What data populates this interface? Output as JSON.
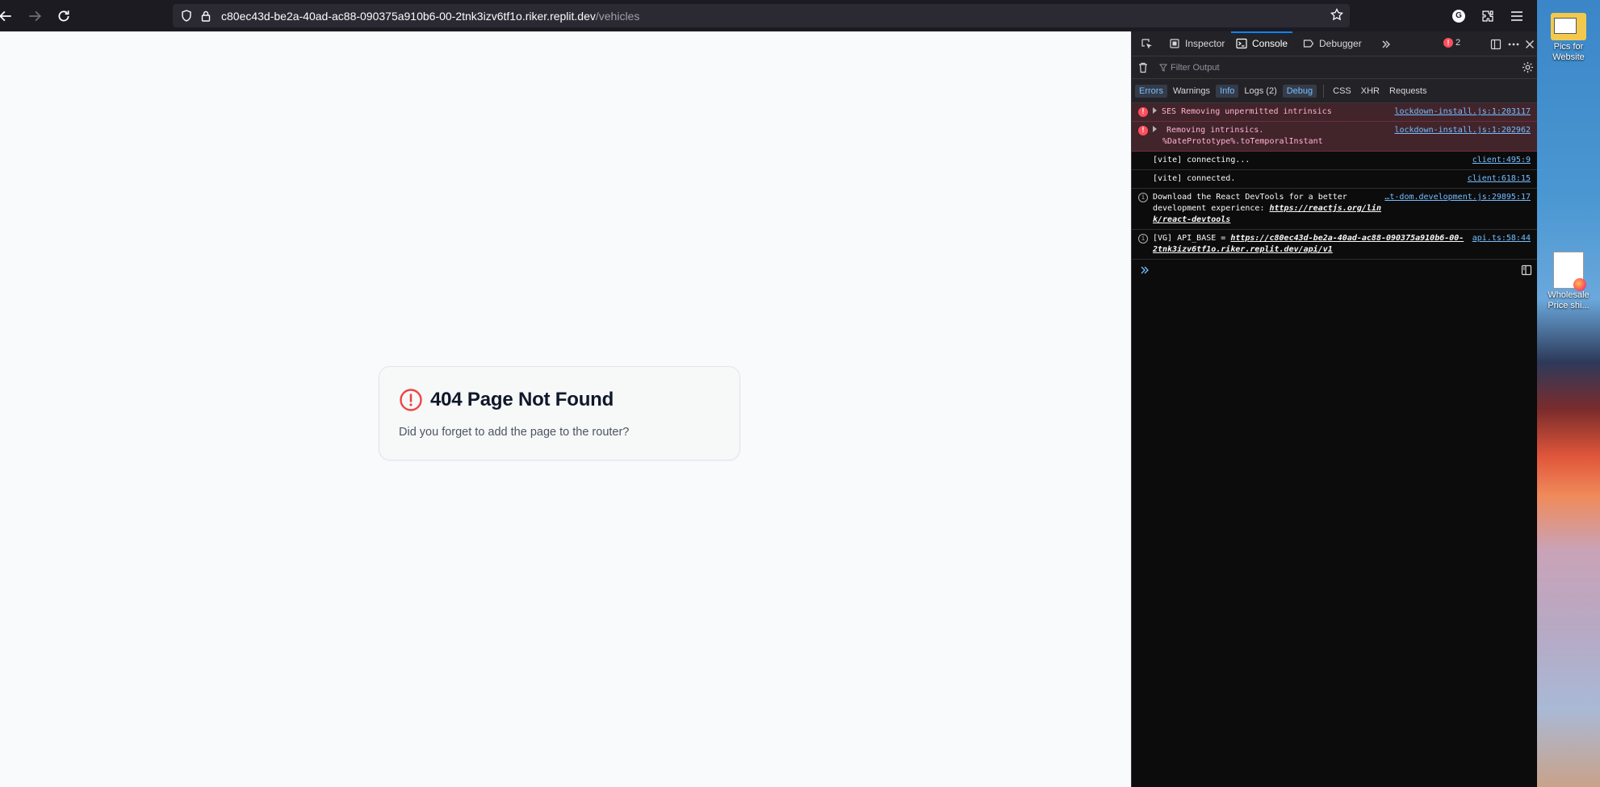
{
  "browser": {
    "url_host": "c80ec43d-be2a-40ad-ac88-090375a910b6-00-2tnk3izv6tf1o.riker.replit.dev",
    "url_path": "/vehicles",
    "extension_badge": "G"
  },
  "page": {
    "title": "404 Page Not Found",
    "message": "Did you forget to add the page to the router?"
  },
  "devtools": {
    "tabs": {
      "inspector": "Inspector",
      "console": "Console",
      "debugger": "Debugger"
    },
    "error_count": "2",
    "filter_placeholder": "Filter Output",
    "levels": {
      "errors": "Errors",
      "warnings": "Warnings",
      "info": "Info",
      "logs": "Logs (2)",
      "debug": "Debug",
      "css": "CSS",
      "xhr": "XHR",
      "requests": "Requests"
    },
    "messages": [
      {
        "type": "error",
        "text": "SES Removing unpermitted intrinsics",
        "source": "lockdown-install.js:1:203117"
      },
      {
        "type": "error",
        "text": "Removing intrinsics.",
        "text2": "%DatePrototype%.toTemporalInstant",
        "source": "lockdown-install.js:1:202962"
      },
      {
        "type": "log",
        "text": "[vite] connecting...",
        "source": "client:495:9"
      },
      {
        "type": "log",
        "text": "[vite] connected.",
        "source": "client:618:15"
      },
      {
        "type": "info",
        "text": "Download the React DevTools for a better development experience: ",
        "link": "https://reactjs.org/link/react-devtools",
        "source": "…t-dom.development.js:29895:17"
      },
      {
        "type": "info",
        "text": "[VG] API_BASE = ",
        "link": "https://c80ec43d-be2a-40ad-ac88-090375a910b6-00-2tnk3izv6tf1o.riker.replit.dev/api/v1",
        "source": "api.ts:58:44"
      }
    ]
  },
  "desktop": {
    "icons": [
      {
        "label": "Pics for Website"
      },
      {
        "label": "Wholesale Price shi..."
      }
    ]
  },
  "colors": {
    "page_bg": "#f8fafc",
    "alert_red": "#ef4444",
    "devtools_bg": "#0c0c0d",
    "link_blue": "#75bfff"
  }
}
